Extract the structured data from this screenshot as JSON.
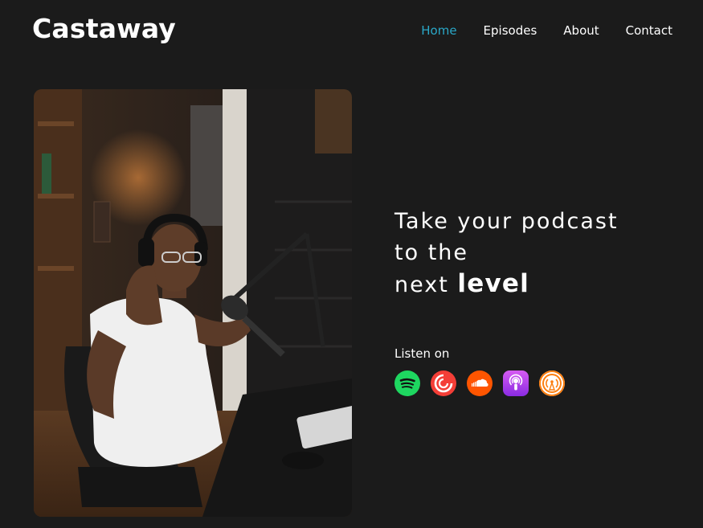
{
  "brand": {
    "logo_text": "Castaway"
  },
  "nav": {
    "items": [
      {
        "label": "Home",
        "active": true
      },
      {
        "label": "Episodes",
        "active": false
      },
      {
        "label": "About",
        "active": false
      },
      {
        "label": "Contact",
        "active": false
      }
    ]
  },
  "hero": {
    "headline_line1": "Take your podcast",
    "headline_line2": "to the",
    "headline_line3_prefix": "next",
    "headline_line3_bold": "level",
    "image_description_icon": "podcaster-photo"
  },
  "listen": {
    "label": "Listen on",
    "platforms": [
      {
        "icon": "spotify-icon",
        "color": "#1ed760"
      },
      {
        "icon": "pocketcasts-icon",
        "color": "#f43e37"
      },
      {
        "icon": "soundcloud-icon",
        "color": "#ff5500"
      },
      {
        "icon": "apple-podcasts-icon",
        "color": "#9933cc"
      },
      {
        "icon": "overcast-icon",
        "color": "#fc7e0f"
      }
    ]
  },
  "colors": {
    "background": "#1b1b1b",
    "accent": "#2aa8c8",
    "text": "#ffffff"
  }
}
